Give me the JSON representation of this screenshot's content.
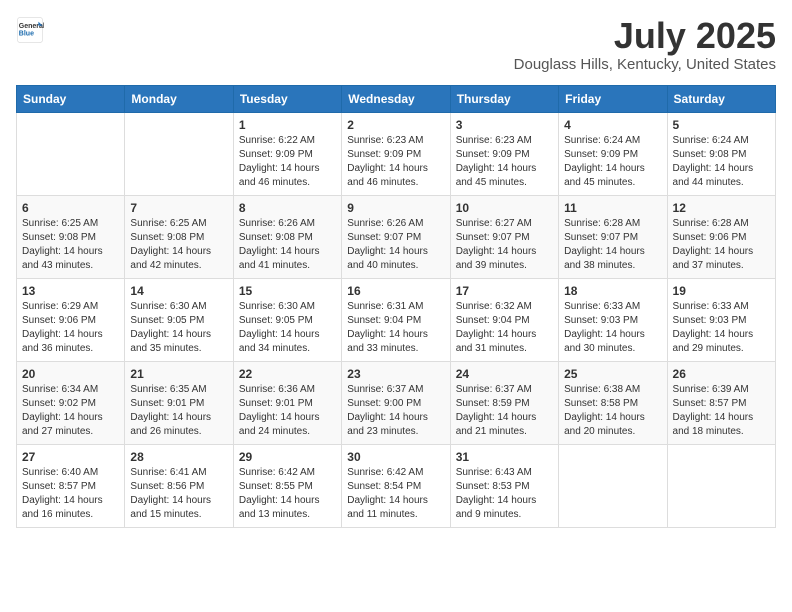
{
  "header": {
    "logo_general": "General",
    "logo_blue": "Blue",
    "title": "July 2025",
    "location": "Douglass Hills, Kentucky, United States"
  },
  "calendar": {
    "weekdays": [
      "Sunday",
      "Monday",
      "Tuesday",
      "Wednesday",
      "Thursday",
      "Friday",
      "Saturday"
    ],
    "weeks": [
      [
        {
          "day": "",
          "sunrise": "",
          "sunset": "",
          "daylight": ""
        },
        {
          "day": "",
          "sunrise": "",
          "sunset": "",
          "daylight": ""
        },
        {
          "day": "1",
          "sunrise": "Sunrise: 6:22 AM",
          "sunset": "Sunset: 9:09 PM",
          "daylight": "Daylight: 14 hours and 46 minutes."
        },
        {
          "day": "2",
          "sunrise": "Sunrise: 6:23 AM",
          "sunset": "Sunset: 9:09 PM",
          "daylight": "Daylight: 14 hours and 46 minutes."
        },
        {
          "day": "3",
          "sunrise": "Sunrise: 6:23 AM",
          "sunset": "Sunset: 9:09 PM",
          "daylight": "Daylight: 14 hours and 45 minutes."
        },
        {
          "day": "4",
          "sunrise": "Sunrise: 6:24 AM",
          "sunset": "Sunset: 9:09 PM",
          "daylight": "Daylight: 14 hours and 45 minutes."
        },
        {
          "day": "5",
          "sunrise": "Sunrise: 6:24 AM",
          "sunset": "Sunset: 9:08 PM",
          "daylight": "Daylight: 14 hours and 44 minutes."
        }
      ],
      [
        {
          "day": "6",
          "sunrise": "Sunrise: 6:25 AM",
          "sunset": "Sunset: 9:08 PM",
          "daylight": "Daylight: 14 hours and 43 minutes."
        },
        {
          "day": "7",
          "sunrise": "Sunrise: 6:25 AM",
          "sunset": "Sunset: 9:08 PM",
          "daylight": "Daylight: 14 hours and 42 minutes."
        },
        {
          "day": "8",
          "sunrise": "Sunrise: 6:26 AM",
          "sunset": "Sunset: 9:08 PM",
          "daylight": "Daylight: 14 hours and 41 minutes."
        },
        {
          "day": "9",
          "sunrise": "Sunrise: 6:26 AM",
          "sunset": "Sunset: 9:07 PM",
          "daylight": "Daylight: 14 hours and 40 minutes."
        },
        {
          "day": "10",
          "sunrise": "Sunrise: 6:27 AM",
          "sunset": "Sunset: 9:07 PM",
          "daylight": "Daylight: 14 hours and 39 minutes."
        },
        {
          "day": "11",
          "sunrise": "Sunrise: 6:28 AM",
          "sunset": "Sunset: 9:07 PM",
          "daylight": "Daylight: 14 hours and 38 minutes."
        },
        {
          "day": "12",
          "sunrise": "Sunrise: 6:28 AM",
          "sunset": "Sunset: 9:06 PM",
          "daylight": "Daylight: 14 hours and 37 minutes."
        }
      ],
      [
        {
          "day": "13",
          "sunrise": "Sunrise: 6:29 AM",
          "sunset": "Sunset: 9:06 PM",
          "daylight": "Daylight: 14 hours and 36 minutes."
        },
        {
          "day": "14",
          "sunrise": "Sunrise: 6:30 AM",
          "sunset": "Sunset: 9:05 PM",
          "daylight": "Daylight: 14 hours and 35 minutes."
        },
        {
          "day": "15",
          "sunrise": "Sunrise: 6:30 AM",
          "sunset": "Sunset: 9:05 PM",
          "daylight": "Daylight: 14 hours and 34 minutes."
        },
        {
          "day": "16",
          "sunrise": "Sunrise: 6:31 AM",
          "sunset": "Sunset: 9:04 PM",
          "daylight": "Daylight: 14 hours and 33 minutes."
        },
        {
          "day": "17",
          "sunrise": "Sunrise: 6:32 AM",
          "sunset": "Sunset: 9:04 PM",
          "daylight": "Daylight: 14 hours and 31 minutes."
        },
        {
          "day": "18",
          "sunrise": "Sunrise: 6:33 AM",
          "sunset": "Sunset: 9:03 PM",
          "daylight": "Daylight: 14 hours and 30 minutes."
        },
        {
          "day": "19",
          "sunrise": "Sunrise: 6:33 AM",
          "sunset": "Sunset: 9:03 PM",
          "daylight": "Daylight: 14 hours and 29 minutes."
        }
      ],
      [
        {
          "day": "20",
          "sunrise": "Sunrise: 6:34 AM",
          "sunset": "Sunset: 9:02 PM",
          "daylight": "Daylight: 14 hours and 27 minutes."
        },
        {
          "day": "21",
          "sunrise": "Sunrise: 6:35 AM",
          "sunset": "Sunset: 9:01 PM",
          "daylight": "Daylight: 14 hours and 26 minutes."
        },
        {
          "day": "22",
          "sunrise": "Sunrise: 6:36 AM",
          "sunset": "Sunset: 9:01 PM",
          "daylight": "Daylight: 14 hours and 24 minutes."
        },
        {
          "day": "23",
          "sunrise": "Sunrise: 6:37 AM",
          "sunset": "Sunset: 9:00 PM",
          "daylight": "Daylight: 14 hours and 23 minutes."
        },
        {
          "day": "24",
          "sunrise": "Sunrise: 6:37 AM",
          "sunset": "Sunset: 8:59 PM",
          "daylight": "Daylight: 14 hours and 21 minutes."
        },
        {
          "day": "25",
          "sunrise": "Sunrise: 6:38 AM",
          "sunset": "Sunset: 8:58 PM",
          "daylight": "Daylight: 14 hours and 20 minutes."
        },
        {
          "day": "26",
          "sunrise": "Sunrise: 6:39 AM",
          "sunset": "Sunset: 8:57 PM",
          "daylight": "Daylight: 14 hours and 18 minutes."
        }
      ],
      [
        {
          "day": "27",
          "sunrise": "Sunrise: 6:40 AM",
          "sunset": "Sunset: 8:57 PM",
          "daylight": "Daylight: 14 hours and 16 minutes."
        },
        {
          "day": "28",
          "sunrise": "Sunrise: 6:41 AM",
          "sunset": "Sunset: 8:56 PM",
          "daylight": "Daylight: 14 hours and 15 minutes."
        },
        {
          "day": "29",
          "sunrise": "Sunrise: 6:42 AM",
          "sunset": "Sunset: 8:55 PM",
          "daylight": "Daylight: 14 hours and 13 minutes."
        },
        {
          "day": "30",
          "sunrise": "Sunrise: 6:42 AM",
          "sunset": "Sunset: 8:54 PM",
          "daylight": "Daylight: 14 hours and 11 minutes."
        },
        {
          "day": "31",
          "sunrise": "Sunrise: 6:43 AM",
          "sunset": "Sunset: 8:53 PM",
          "daylight": "Daylight: 14 hours and 9 minutes."
        },
        {
          "day": "",
          "sunrise": "",
          "sunset": "",
          "daylight": ""
        },
        {
          "day": "",
          "sunrise": "",
          "sunset": "",
          "daylight": ""
        }
      ]
    ]
  }
}
